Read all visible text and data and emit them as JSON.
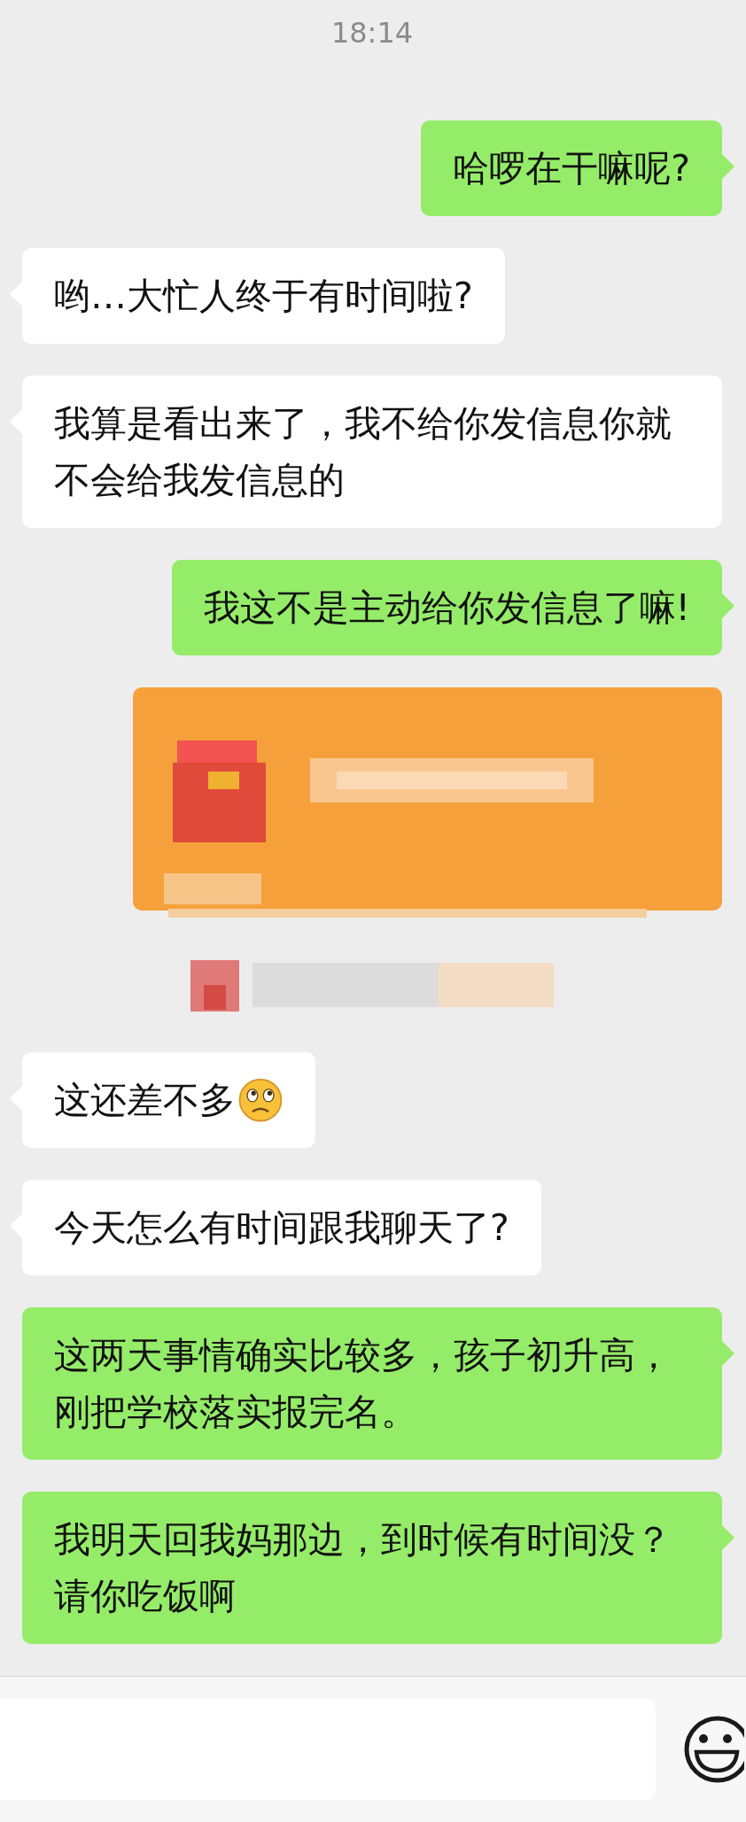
{
  "time": "18:14",
  "messages": [
    {
      "kind": "sent",
      "text": "哈啰在干嘛呢?"
    },
    {
      "kind": "received",
      "text": "哟…大忙人终于有时间啦?"
    },
    {
      "kind": "received",
      "text": "我算是看出来了，我不给你发信息你就不会给我发信息的"
    },
    {
      "kind": "sent",
      "text": "我这不是主动给你发信息了嘛!"
    },
    {
      "kind": "redpacket"
    },
    {
      "kind": "notice"
    },
    {
      "kind": "received",
      "text": "这还差不多",
      "emoji": true
    },
    {
      "kind": "received",
      "text": "今天怎么有时间跟我聊天了?"
    },
    {
      "kind": "sent",
      "text": "这两天事情确实比较多，孩子初升高，刚把学校落实报完名。"
    },
    {
      "kind": "sent",
      "text": "我明天回我妈那边，到时候有时间没？请你吃饭啊"
    }
  ]
}
